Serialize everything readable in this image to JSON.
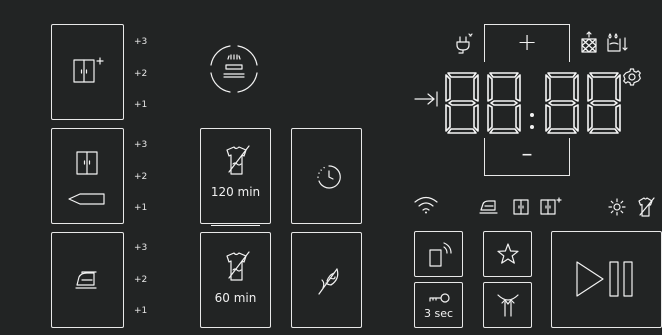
{
  "drying_levels": {
    "cupboard_plus": [
      "+3",
      "+2",
      "+1"
    ],
    "cupboard": [
      "+3",
      "+2",
      "+1"
    ],
    "iron": [
      "+3",
      "+2",
      "+1"
    ]
  },
  "programs": {
    "program_120": "120 min",
    "program_60": "60 min"
  },
  "display": {
    "digit_1": "8",
    "digit_2": "8",
    "colon": ":",
    "digit_3": "8",
    "digit_4": "8",
    "plus_label": "+",
    "minus_label": "–"
  },
  "buttons": {
    "child_lock_label": "3 sec"
  },
  "colors": {
    "background": "#222424",
    "foreground": "#f2f2f2"
  }
}
